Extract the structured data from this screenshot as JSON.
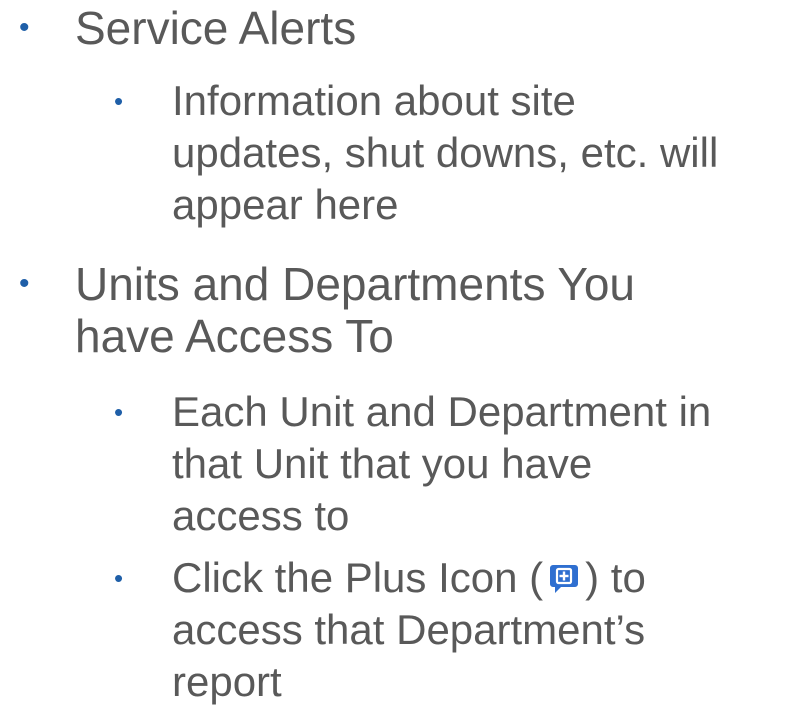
{
  "bullets": [
    {
      "level": 1,
      "lines": [
        "Service Alerts"
      ]
    },
    {
      "level": 2,
      "lines": [
        "Information about site",
        "updates, shut downs, etc. will",
        "appear here"
      ]
    },
    {
      "level": 1,
      "lines": [
        "Units and Departments You",
        "have Access To"
      ]
    },
    {
      "level": 2,
      "lines": [
        "Each Unit and Department in",
        "that Unit that you have",
        "access to"
      ]
    },
    {
      "level": 2,
      "lines_before_icon": "Click the Plus Icon (",
      "lines_after_icon": ") to",
      "icon": "plus-comment-icon",
      "lines": [
        "access that Department’s",
        "report"
      ]
    }
  ],
  "bullet_glyph": "•",
  "colors": {
    "text": "#595959",
    "bullet": "#1f5fa8",
    "icon_fill": "#2f6fd0",
    "icon_plus": "#ffffff"
  }
}
